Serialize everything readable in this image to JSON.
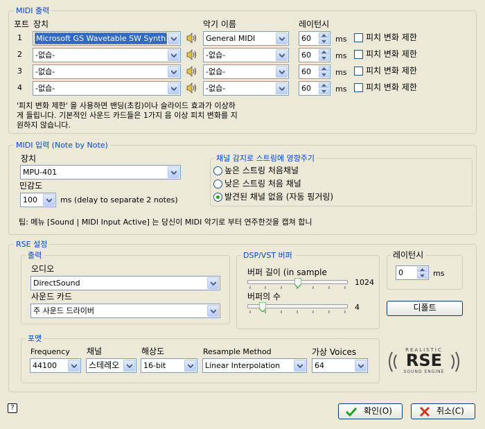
{
  "midi_output": {
    "legend": "MIDI 출력",
    "col_port": "포트",
    "col_device": "장치",
    "col_instrument": "악기 이름",
    "col_latency": "레이턴시",
    "ports": [
      {
        "num": "1",
        "device": "Microsoft GS Wavetable SW Synth",
        "instrument": "General MIDI",
        "latency": "60",
        "unit": "ms",
        "pitch_limit": "피치 변화 제한"
      },
      {
        "num": "2",
        "device": "-없습-",
        "instrument": "-없습-",
        "latency": "60",
        "unit": "ms",
        "pitch_limit": "피치 변화 제한"
      },
      {
        "num": "3",
        "device": "-없습-",
        "instrument": "-없습-",
        "latency": "60",
        "unit": "ms",
        "pitch_limit": "피치 변화 제한"
      },
      {
        "num": "4",
        "device": "-없습-",
        "instrument": "-없습-",
        "latency": "60",
        "unit": "ms",
        "pitch_limit": "피치 변화 제한"
      }
    ],
    "note_line1": "'피치 변화 제한' 을 사용하면 밴딩(초킹)이나 슬라이드 효과가 이상하",
    "note_line2": "게 들립니다. 기본적인 사운드 카드들은 1가지 음 이상 피치 변화를 지",
    "note_line3": "원하지 않습니다."
  },
  "midi_input": {
    "legend": "MIDI 입력 (Note by Note)",
    "device_label": "장치",
    "device": "MPU-401",
    "sensitivity_label": "민감도",
    "sensitivity": "100",
    "sensitivity_note": "ms  (delay to separate 2 notes)",
    "channel_legend": "채널 감지로 스트링에 영향주기",
    "radio1": "높은 스트링 처음채널",
    "radio2": "낮은 스트링 처음 채널",
    "radio3": "발견된 채널 없음 (자동 핑거링)",
    "tip": "팁: 메뉴 [Sound | MIDI Input Active] 는 당신이 MIDI 악기로 부터 연주한것을 캡쳐 합니"
  },
  "rse": {
    "legend": "RSE 설정",
    "output_legend": "출력",
    "audio_label": "오디오",
    "audio": "DirectSound",
    "soundcard_label": "사운드 카드",
    "soundcard": "주 사운드 드라이버",
    "dsp_legend": "DSP/VST 버퍼",
    "buffer_len_label": "버퍼 길이 (in sample",
    "buffer_len": "1024",
    "buffer_count_label": "버퍼의 수",
    "buffer_count": "4",
    "latency_legend": "레이턴시",
    "latency": "0",
    "latency_unit": "ms",
    "default_button": "디폴트",
    "format_legend": "포맷",
    "frequency_label": "Frequency",
    "frequency": "44100",
    "channel_label": "채널",
    "channel": "스테레오",
    "resolution_label": "해상도",
    "resolution": "16-bit",
    "resample_label": "Resample Method",
    "resample": "Linear Interpolation",
    "voices_label": "가상 Voices",
    "voices": "64",
    "logo_top": "REALISTIC",
    "logo_main": "RSE",
    "logo_bottom": "SOUND ENGINE"
  },
  "footer": {
    "help": "?",
    "ok": "확인(O)",
    "cancel": "취소(C)"
  },
  "colors": {
    "background": "#ece9d8",
    "legend_blue": "#0046d5",
    "selection": "#316ac5",
    "ok_check": "#21a121",
    "cancel_x": "#d2381d"
  }
}
